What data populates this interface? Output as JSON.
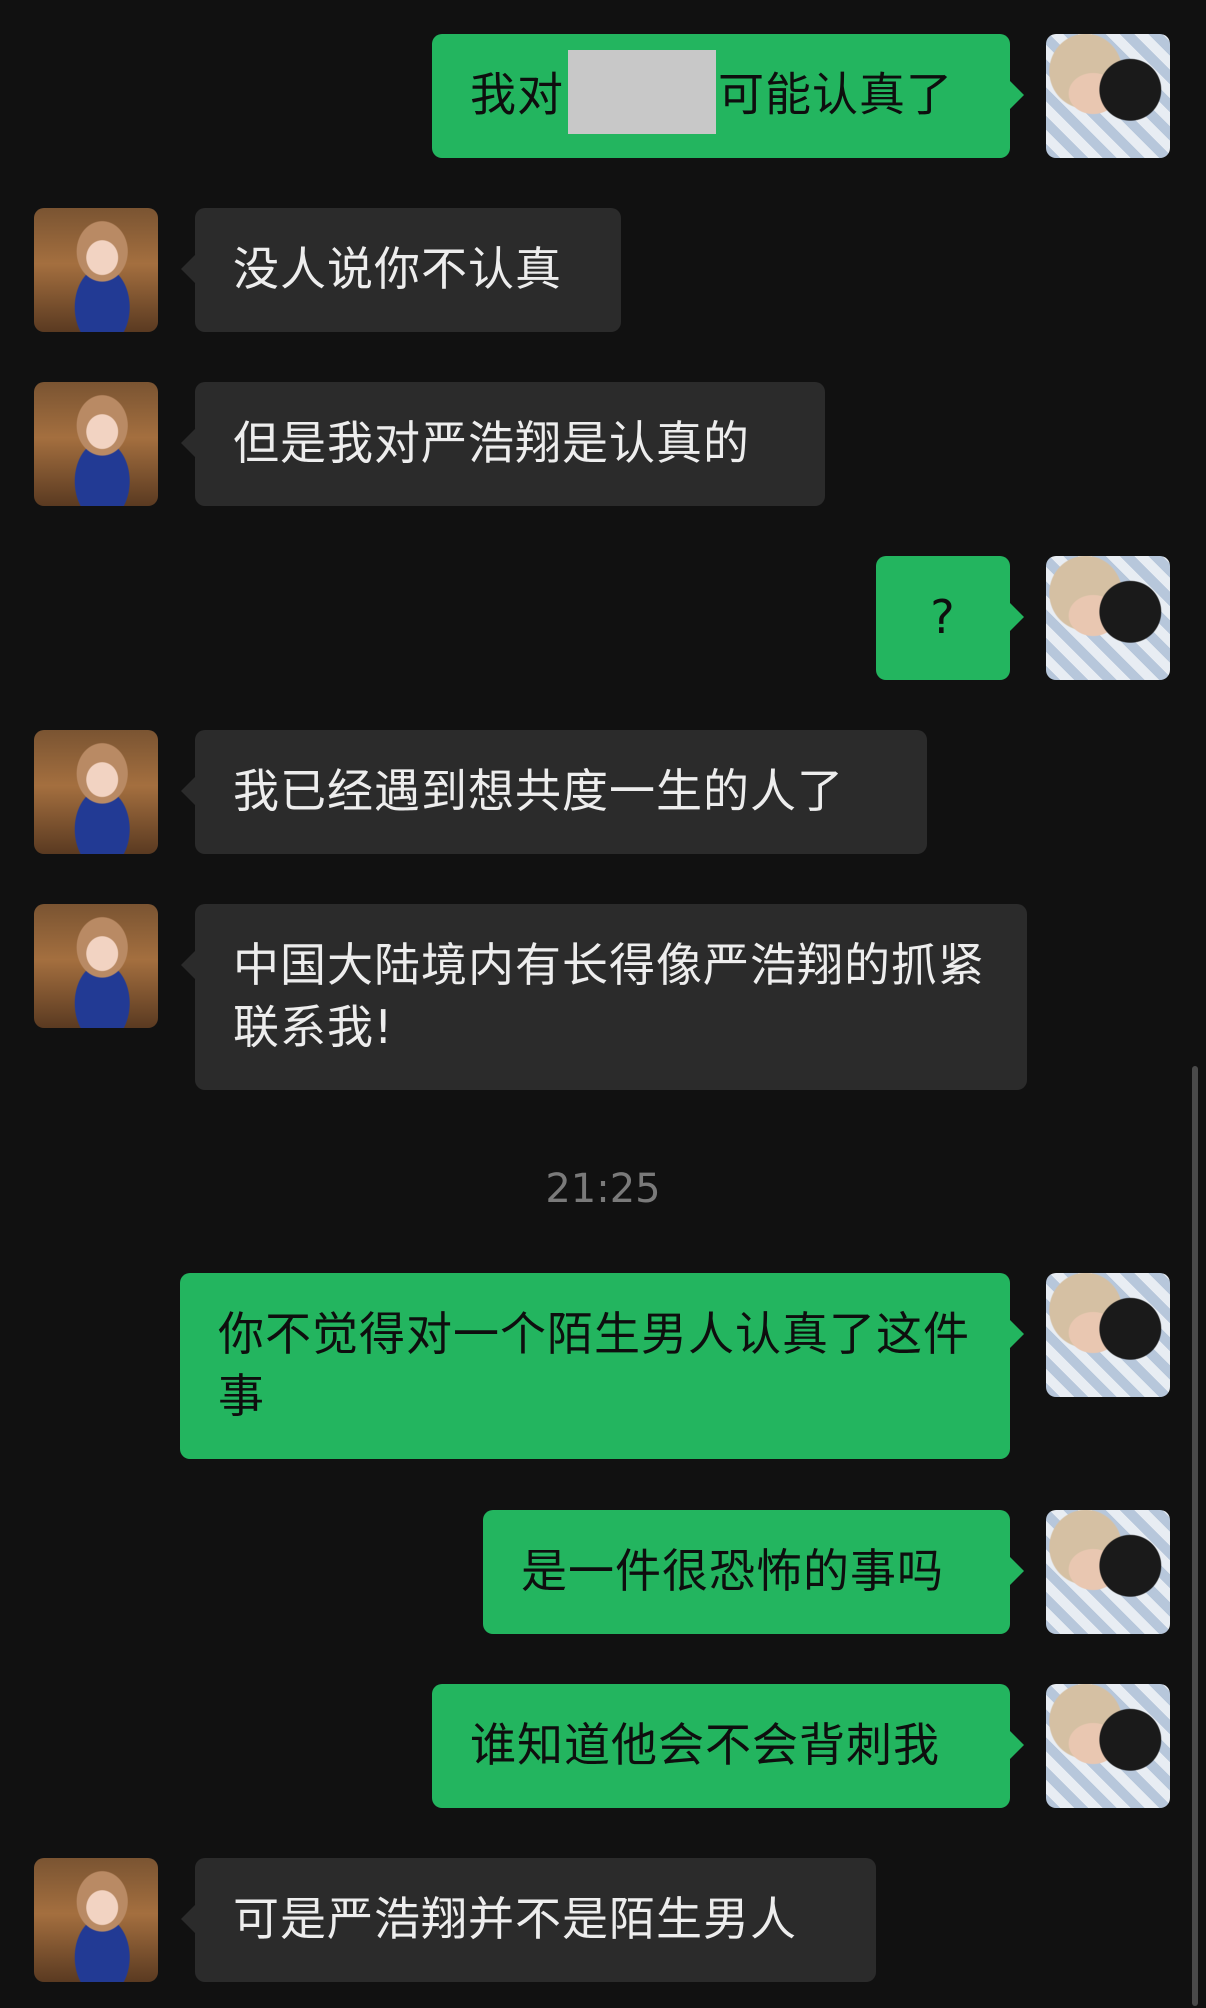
{
  "messages": [
    {
      "side": "right",
      "parts": [
        "我对",
        "可能认真了"
      ],
      "redacted": true
    },
    {
      "side": "left",
      "text": "没人说你不认真"
    },
    {
      "side": "left",
      "text": "但是我对严浩翔是认真的"
    },
    {
      "side": "right",
      "text": "?"
    },
    {
      "side": "left",
      "text": "我已经遇到想共度一生的人了"
    },
    {
      "side": "left",
      "text": "中国大陆境内有长得像严浩翔的抓紧联系我!"
    },
    {
      "side": "right",
      "text": "你不觉得对一个陌生男人认真了这件事"
    },
    {
      "side": "right",
      "text": "是一件很恐怖的事吗"
    },
    {
      "side": "right",
      "text": "谁知道他会不会背刺我"
    },
    {
      "side": "left",
      "text": "可是严浩翔并不是陌生男人"
    }
  ],
  "timestamp": "21:25",
  "colors": {
    "background": "#111111",
    "outgoing_bubble": "#23b55f",
    "incoming_bubble": "#2b2b2b",
    "incoming_text": "#ededed",
    "timestamp_text": "#7a7a7a"
  },
  "icons": {
    "my_avatar": "user-avatar-icon",
    "contact_avatar": "contact-avatar-icon"
  }
}
